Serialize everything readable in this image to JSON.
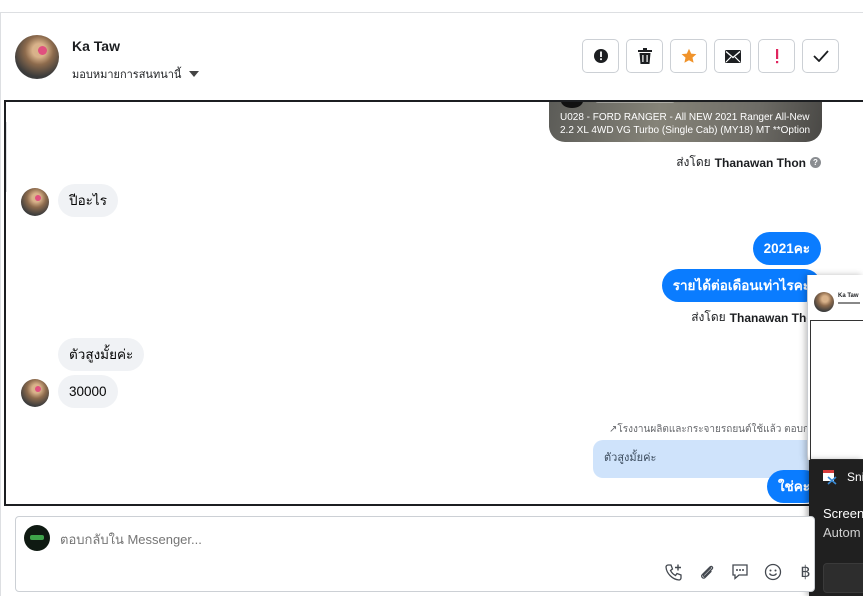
{
  "header": {
    "contact_name": "Ka Taw",
    "assign_label": "มอบหมายการสนทนานี้",
    "actions": [
      {
        "name": "spam-button",
        "icon": "alert-circle-icon"
      },
      {
        "name": "delete-button",
        "icon": "trash-icon"
      },
      {
        "name": "star-button",
        "icon": "star-icon"
      },
      {
        "name": "mark-unread-button",
        "icon": "envelope-icon"
      },
      {
        "name": "follow-up-button",
        "icon": "exclamation-icon"
      },
      {
        "name": "done-button",
        "icon": "check-icon"
      }
    ]
  },
  "conversation": {
    "media_card_text": "U028 - FORD RANGER - All NEW 2021 Ranger All-New 2.2 XL 4WD VG Turbo (Single Cab) (MY18) MT **Option",
    "sent_by_prefix": "ส่งโดย",
    "agent_name": "Thanawan Thon",
    "messages": [
      {
        "from": "customer",
        "text": "ปีอะไร"
      },
      {
        "from": "page",
        "text": "2021คะ"
      },
      {
        "from": "page",
        "text": "รายได้ต่อเดือนเท่าไรคะ"
      },
      {
        "from": "customer",
        "text": "ตัวสูงมั้ยค่ะ"
      },
      {
        "from": "customer",
        "text": "30000"
      },
      {
        "from": "page",
        "text": "ใช่คะ"
      }
    ],
    "reply_note": "↗โรงงานผลิตและกระจายรถยนต์ใช้แล้ว ตอบกลับ",
    "quoted_text": "ตัวสูงมั้ยค่ะ"
  },
  "overlay": {
    "popup_name": "Ka Taw",
    "snip_title": "Snip",
    "snip_line1": "Screen",
    "snip_line2": "Autom"
  },
  "composer": {
    "placeholder": "ตอบกลับใน Messenger...",
    "currency_symbol": "฿"
  },
  "colors": {
    "accent_blue": "#0a7cff",
    "incoming_bubble": "#f0f2f5",
    "star": "#f0932b",
    "flag_red": "#e0245e"
  }
}
